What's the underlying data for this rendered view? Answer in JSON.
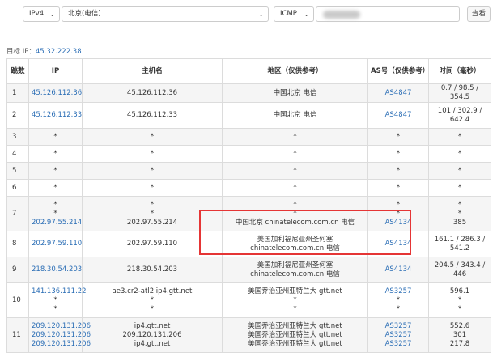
{
  "toolbar": {
    "ipv_value": "IPv4",
    "location_value": "北京(电信)",
    "protocol_value": "ICMP",
    "submit_label": "查看"
  },
  "target": {
    "label": "目标 IP：",
    "ip": "45.32.222.38"
  },
  "table": {
    "headers": {
      "hop": "跳数",
      "ip": "IP",
      "host": "主机名",
      "region": "地区（仅供参考）",
      "as": "AS号（仅供参考）",
      "time": "时间（毫秒）"
    },
    "rows": [
      {
        "hop": "1",
        "ip": "45.126.112.36",
        "host": "45.126.112.36",
        "region": "中国北京 电信",
        "as": "AS4847",
        "time": "0.7 / 98.5 / 354.5"
      },
      {
        "hop": "2",
        "ip": "45.126.112.33",
        "host": "45.126.112.33",
        "region": "中国北京 电信",
        "as": "AS4847",
        "time": "101 / 302.9 / 642.4"
      },
      {
        "hop": "3",
        "ip": "*",
        "host": "*",
        "region": "*",
        "as": "*",
        "time": "*"
      },
      {
        "hop": "4",
        "ip": "*",
        "host": "*",
        "region": "*",
        "as": "*",
        "time": "*"
      },
      {
        "hop": "5",
        "ip": "*",
        "host": "*",
        "region": "*",
        "as": "*",
        "time": "*"
      },
      {
        "hop": "6",
        "ip": "*",
        "host": "*",
        "region": "*",
        "as": "*",
        "time": "*"
      },
      {
        "hop": "7",
        "lines": [
          {
            "ip": "*",
            "host": "*",
            "region": "*",
            "as": "*",
            "time": "*"
          },
          {
            "ip": "*",
            "host": "*",
            "region": "*",
            "as": "*",
            "time": "*"
          },
          {
            "ip": "202.97.55.214",
            "host": "202.97.55.214",
            "region": "中国北京 chinatelecom.com.cn 电信",
            "as": "AS4134",
            "time": "385"
          }
        ]
      },
      {
        "hop": "8",
        "ip": "202.97.59.110",
        "host": "202.97.59.110",
        "region": "美国加利福尼亚州圣何塞 chinatelecom.com.cn 电信",
        "as": "AS4134",
        "time": "161.1 / 286.3 / 541.2"
      },
      {
        "hop": "9",
        "ip": "218.30.54.203",
        "host": "218.30.54.203",
        "region": "美国加利福尼亚州圣何塞 chinatelecom.com.cn 电信",
        "as": "AS4134",
        "time": "204.5 / 343.4 / 446"
      },
      {
        "hop": "10",
        "lines": [
          {
            "ip": "141.136.111.22",
            "host": "ae3.cr2-atl2.ip4.gtt.net",
            "region": "美国乔治亚州亚特兰大 gtt.net",
            "as": "AS3257",
            "time": "596.1"
          },
          {
            "ip": "*",
            "host": "*",
            "region": "*",
            "as": "*",
            "time": "*"
          },
          {
            "ip": "*",
            "host": "*",
            "region": "*",
            "as": "*",
            "time": "*"
          }
        ]
      },
      {
        "hop": "11",
        "lines": [
          {
            "ip": "209.120.131.206",
            "host": "ip4.gtt.net",
            "region": "美国乔治亚州亚特兰大 gtt.net",
            "as": "AS3257",
            "time": "552.6"
          },
          {
            "ip": "209.120.131.206",
            "host": "209.120.131.206",
            "region": "美国乔治亚州亚特兰大 gtt.net",
            "as": "AS3257",
            "time": "301"
          },
          {
            "ip": "209.120.131.206",
            "host": "ip4.gtt.net",
            "region": "美国乔治亚州亚特兰大 gtt.net",
            "as": "AS3257",
            "time": "217.8"
          }
        ]
      }
    ]
  }
}
